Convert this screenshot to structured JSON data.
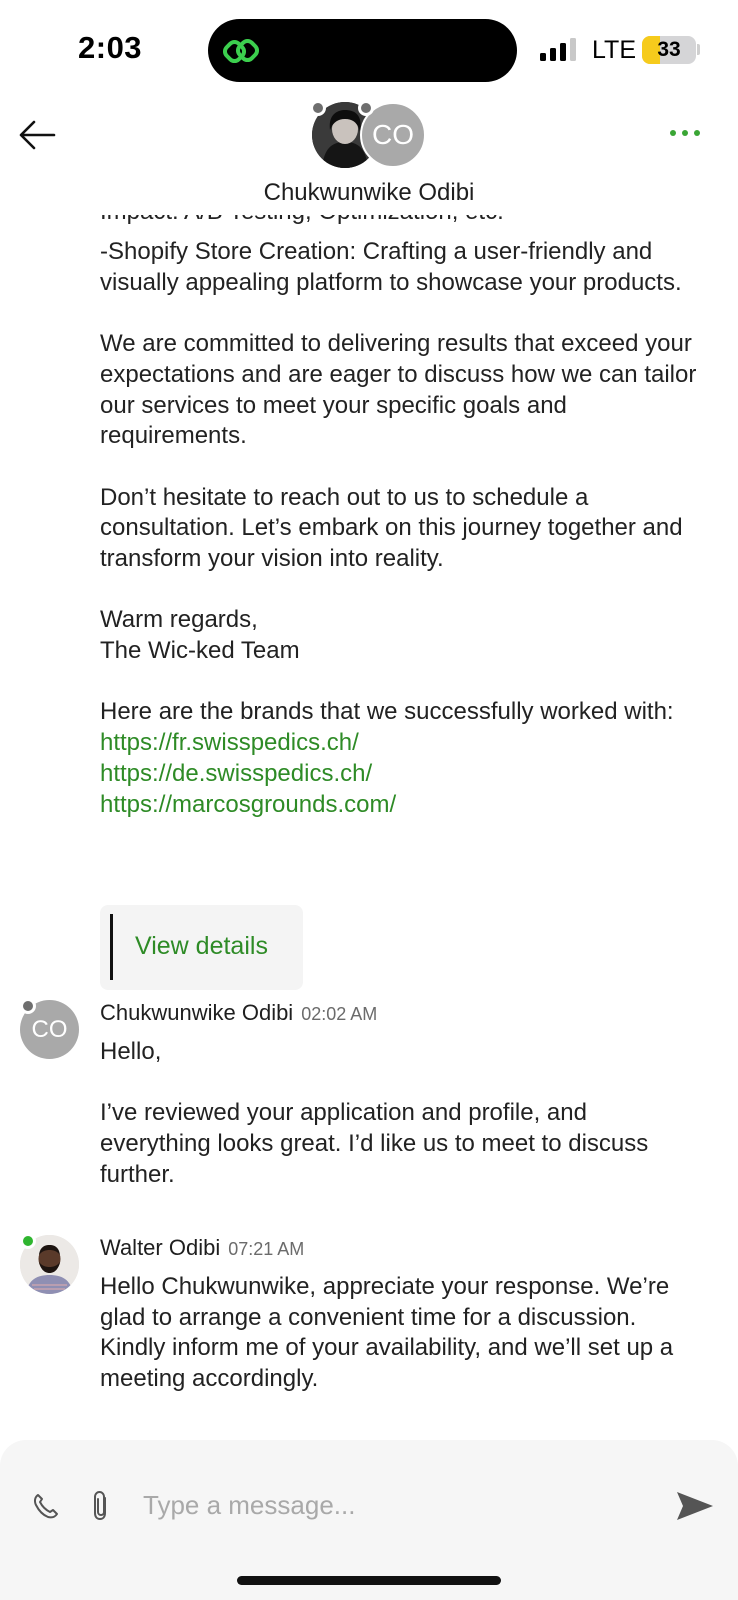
{
  "status_bar": {
    "time": "2:03",
    "network": "LTE",
    "battery_level": "33",
    "battery_fraction": 0.33,
    "signal_bars": 3
  },
  "header": {
    "contact_name": "Chukwunwike Odibi",
    "avatar_initials": "CO",
    "back_icon": "back-arrow-icon",
    "more_icon": "more-dots-icon"
  },
  "thread": {
    "partial_top_line": "Impact: A/B Testing, Optimization, etc.",
    "first_message": {
      "paragraphs": [
        "-Shopify Store Creation: Crafting a user-friendly and visually appealing platform to showcase your products.",
        "We are committed to delivering results that exceed your expectations and are eager to discuss how we can tailor our services to meet your specific goals and requirements.",
        "Don’t hesitate to reach out to us to schedule a consultation. Let’s embark on this journey together and transform your vision into reality."
      ],
      "signoff_line1": "Warm regards,",
      "signoff_line2": "The Wic-ked Team",
      "brands_intro": "Here are the brands that we successfully worked with:",
      "links": [
        "https://fr.swisspedics.ch/",
        "https://de.swisspedics.ch/",
        "https://marcosgrounds.com/"
      ],
      "view_details_label": "View details"
    },
    "messages": [
      {
        "sender": "Chukwunwike Odibi",
        "initials": "CO",
        "time": "02:02 AM",
        "paragraphs": [
          "Hello,",
          "I’ve reviewed your application and profile, and everything looks great. I’d like us to meet to discuss further."
        ]
      },
      {
        "sender": "Walter Odibi",
        "time": "07:21 AM",
        "paragraphs": [
          "Hello Chukwunwike, appreciate your response. We’re glad to arrange a convenient time for a discussion. Kindly inform me of your availability, and we’ll set up a meeting accordingly."
        ]
      }
    ]
  },
  "composer": {
    "placeholder": "Type a message...",
    "call_icon": "phone-icon",
    "attach_icon": "paperclip-icon",
    "send_icon": "send-icon"
  },
  "colors": {
    "accent_green": "#2e8b26",
    "online_green": "#2fb52f",
    "offline_gray": "#6e6e6e",
    "battery_yellow": "#f6cb1c"
  }
}
